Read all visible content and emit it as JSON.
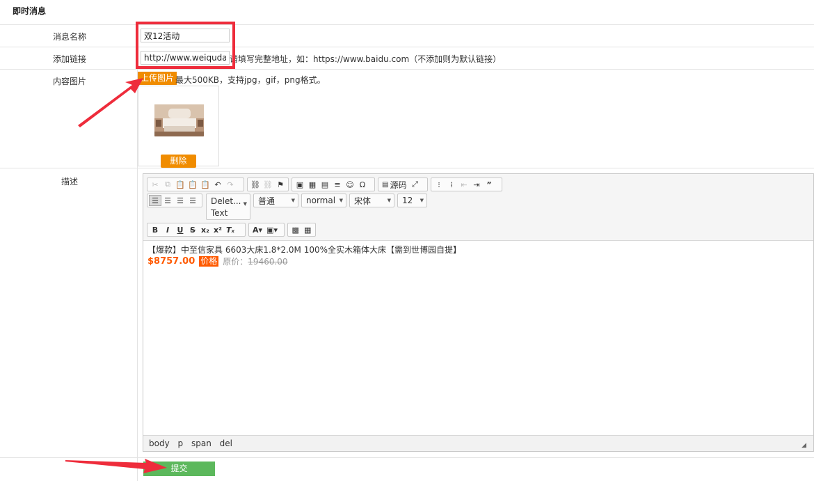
{
  "page_title": "即时消息",
  "form": {
    "name_label": "消息名称",
    "name_value": "双12活动",
    "link_label": "添加链接",
    "link_value": "http://www.weiqudao.cn",
    "link_hint": "请填写完整地址，如：https://www.baidu.com（不添加则为默认链接）",
    "image_label": "内容图片",
    "upload_label": "上传图片",
    "upload_hint": "最大500KB，支持jpg，gif，png格式。",
    "delete_label": "删除",
    "desc_label": "描述",
    "submit_label": "提交"
  },
  "editor": {
    "source_label": "源码",
    "style_combo_line1": "Delet...",
    "style_combo_line2": "Text",
    "paragraph_combo": "普通",
    "weight_combo": "normal",
    "font_combo": "宋体",
    "size_combo": "12",
    "content_line1": "【爆款】中至信家具 6603大床1.8*2.0M 100%全实木箱体大床【需到世博园自提】",
    "price": "$8757.00",
    "price_tag": "价格",
    "original_prefix": "原价：",
    "original_price": "19460.00",
    "status_path": [
      "body",
      "p",
      "span",
      "del"
    ]
  },
  "colors": {
    "accent_orange": "#f08c00",
    "price_orange": "#ff5a00",
    "submit_green": "#5cb85c",
    "annotation_red": "#ee2c3b"
  }
}
